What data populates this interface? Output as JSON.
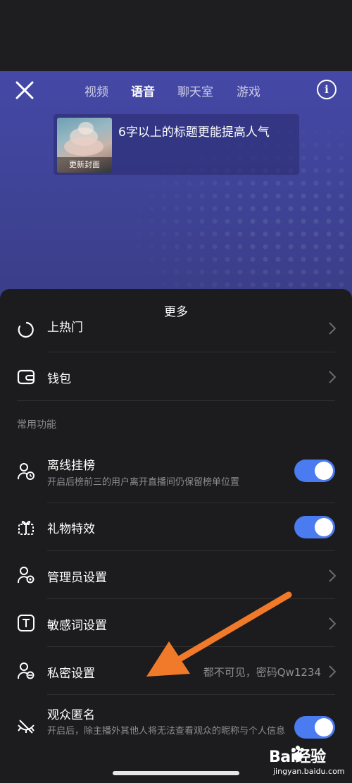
{
  "header": {
    "tabs": [
      "视频",
      "语音",
      "聊天室",
      "游戏"
    ],
    "active_tab_index": 1
  },
  "cover": {
    "label": "更新封面",
    "title": "6字以上的标题更能提高人气"
  },
  "sheet": {
    "title": "更多",
    "partial_item": {
      "label": "上热门"
    },
    "wallet": {
      "label": "钱包"
    },
    "section_label": "常用功能",
    "items": [
      {
        "label": "离线挂榜",
        "subtitle": "开启后榜前三的用户离开直播间仍保留榜单位置",
        "control": "toggle",
        "on": true
      },
      {
        "label": "礼物特效",
        "control": "toggle",
        "on": true
      },
      {
        "label": "管理员设置",
        "control": "chevron"
      },
      {
        "label": "敏感词设置",
        "control": "chevron"
      },
      {
        "label": "私密设置",
        "value": "都不可见，密码Qw1234",
        "control": "chevron"
      },
      {
        "label": "观众匿名",
        "subtitle": "开启后，除主播外其他人将无法查看观众的昵称与个人信息",
        "control": "toggle",
        "on": true
      }
    ]
  },
  "watermark": {
    "brand": "Bai经验",
    "url": "jingyan.baidu.com"
  },
  "colors": {
    "hero": "#4548a6",
    "sheet_bg": "#1c1c1e",
    "toggle_on": "#4a7bf0",
    "annotation_arrow": "#f07a2a"
  }
}
